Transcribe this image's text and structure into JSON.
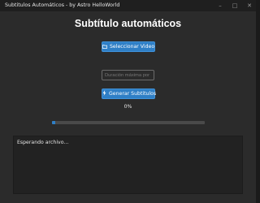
{
  "window": {
    "title": "Subtitulos Automáticos - by Astro HelloWorld",
    "controls": {
      "minimize_icon": "minimize-icon",
      "maximize_icon": "maximize-icon",
      "close_icon": "close-icon"
    }
  },
  "main": {
    "heading": "Subtítulo automáticos",
    "select_video_button": {
      "icon": "folder-icon",
      "label": "Seleccionar Video"
    },
    "duration_input": {
      "placeholder": "Duración máxima por s",
      "value": ""
    },
    "generate_button": {
      "icon": "lightning-icon",
      "label": "Generar Subtitulos"
    },
    "progress": {
      "percent_text": "0%",
      "fraction": 0.02
    },
    "log": {
      "text": "Esperando archivo..."
    }
  },
  "colors": {
    "accent": "#2f7fc6",
    "background": "#2b2b2b",
    "titlebar": "#1f1f1f",
    "log_background": "#222222"
  }
}
